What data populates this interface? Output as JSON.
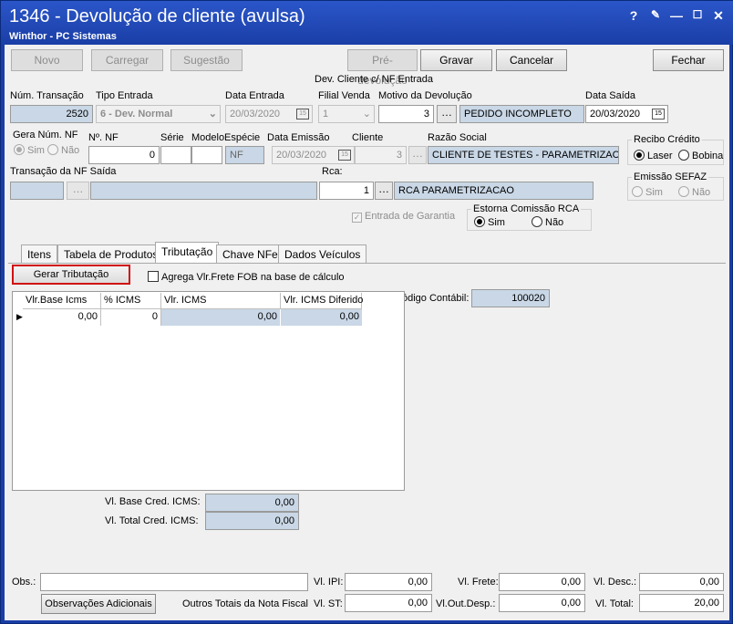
{
  "window": {
    "title": "1346 - Devolução de cliente (avulsa)",
    "subtitle": "Winthor - PC Sistemas",
    "help": "?",
    "minimize": "—",
    "maximize": "☐",
    "close": "✕",
    "restore": "⬜"
  },
  "toolbar": {
    "novo": "Novo",
    "carregar": "Carregar",
    "sugestao": "Sugestão",
    "pre_devolucao": "Pré-devolução",
    "gravar": "Gravar",
    "cancelar": "Cancelar",
    "fechar": "Fechar"
  },
  "header": {
    "section_label": "Dev. Cliente c/ NF Entrada"
  },
  "row1": {
    "num_transacao_label": "Núm. Transação",
    "num_transacao": "2520",
    "tipo_entrada_label": "Tipo Entrada",
    "tipo_entrada": "6 - Dev. Normal",
    "data_entrada_label": "Data Entrada",
    "data_entrada": "20/03/2020",
    "filial_venda_label": "Filial Venda",
    "filial_venda": "1",
    "motivo_label": "Motivo da Devolução",
    "motivo_code": "3",
    "motivo_desc": "PEDIDO INCOMPLETO",
    "data_saida_label": "Data Saída",
    "data_saida": "20/03/2020"
  },
  "row2": {
    "gera_num_nf_label": "Gera Núm. NF",
    "sim": "Sim",
    "nao": "Não",
    "no_nf_label": "Nº. NF",
    "no_nf": "0",
    "serie_label": "Série",
    "modelo_label": "Modelo",
    "especie_label": "Espécie",
    "especie": "NF",
    "data_emissao_label": "Data Emissão",
    "data_emissao": "20/03/2020",
    "cliente_label": "Cliente",
    "cliente": "3",
    "razao_social_label": "Razão Social",
    "razao_social": "CLIENTE DE TESTES - PARAMETRIZACAO"
  },
  "recibo": {
    "label": "Recibo Crédito",
    "laser": "Laser",
    "bobina": "Bobina"
  },
  "emissao_sefaz": {
    "label": "Emissão SEFAZ",
    "sim": "Sim",
    "nao": "Não"
  },
  "row3": {
    "transacao_nf_saida_label": "Transação da NF Saída",
    "rca_label": "Rca:",
    "rca": "1",
    "rca_desc": "RCA PARAMETRIZACAO",
    "entrada_garantia": "Entrada de Garantia"
  },
  "estorna": {
    "label": "Estorna Comissão RCA",
    "sim": "Sim",
    "nao": "Não"
  },
  "tabs": [
    "Itens",
    "Tabela de Produtos",
    "Tributação",
    "Chave NFe",
    "Dados Veículos"
  ],
  "tributacao": {
    "gerar": "Gerar Tributação",
    "agrega": "Agrega Vlr.Frete FOB na base de cálculo",
    "codigo_contabil_label": "ódigo Contábil:",
    "codigo_contabil": "100020"
  },
  "grid": {
    "headers": [
      "Vlr.Base Icms",
      "% ICMS",
      "Vlr. ICMS",
      "Vlr. ICMS Diferido"
    ],
    "row": [
      "0,00",
      "0",
      "0,00",
      "0,00"
    ]
  },
  "totais_cred": {
    "base_label": "Vl. Base Cred. ICMS:",
    "base": "0,00",
    "total_label": "Vl. Total Cred. ICMS:",
    "total": "0,00"
  },
  "footer": {
    "obs_label": "Obs.:",
    "obs": "",
    "obs_adicionais": "Observações Adicionais",
    "outros_totais": "Outros Totais da Nota Fiscal",
    "ipi_label": "Vl. IPI:",
    "ipi": "0,00",
    "frete_label": "Vl. Frete:",
    "frete": "0,00",
    "desc_label": "Vl. Desc.:",
    "desc": "0,00",
    "st_label": "Vl. ST:",
    "st": "0,00",
    "out_desp_label": "Vl.Out.Desp.:",
    "out_desp": "0,00",
    "total_label": "Vl. Total:",
    "total": "20,00"
  },
  "colors": {
    "titlebar": "#1a3ea6",
    "readonly_field": "#c9d7e6",
    "accent_red": "#d01010"
  }
}
